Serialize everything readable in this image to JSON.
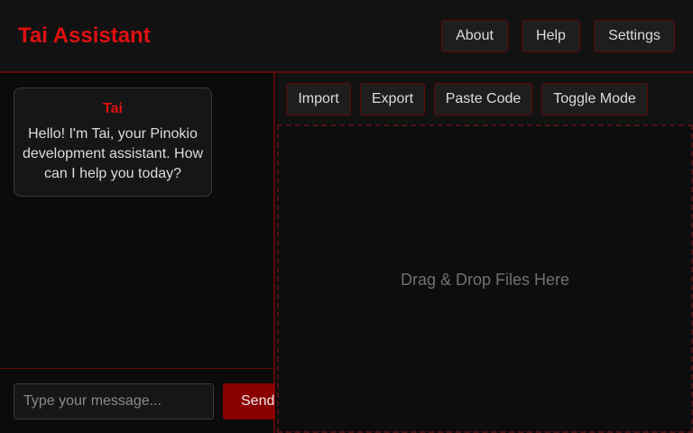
{
  "header": {
    "title": "Tai Assistant",
    "nav": [
      "About",
      "Help",
      "Settings"
    ]
  },
  "chat": {
    "messages": [
      {
        "sender": "Tai",
        "text": "Hello! I'm Tai, your Pinokio development assistant. How can I help you today?"
      }
    ],
    "input_placeholder": "Type your message...",
    "input_value": "",
    "send_label": "Send"
  },
  "editor": {
    "toolbar": [
      "Import",
      "Export",
      "Paste Code",
      "Toggle Mode"
    ],
    "dropzone_text": "Drag & Drop Files Here"
  },
  "colors": {
    "accent": "#e01010",
    "button_primary": "#8a0000",
    "border": "#5a0a0a",
    "background": "#0b0b0b"
  }
}
